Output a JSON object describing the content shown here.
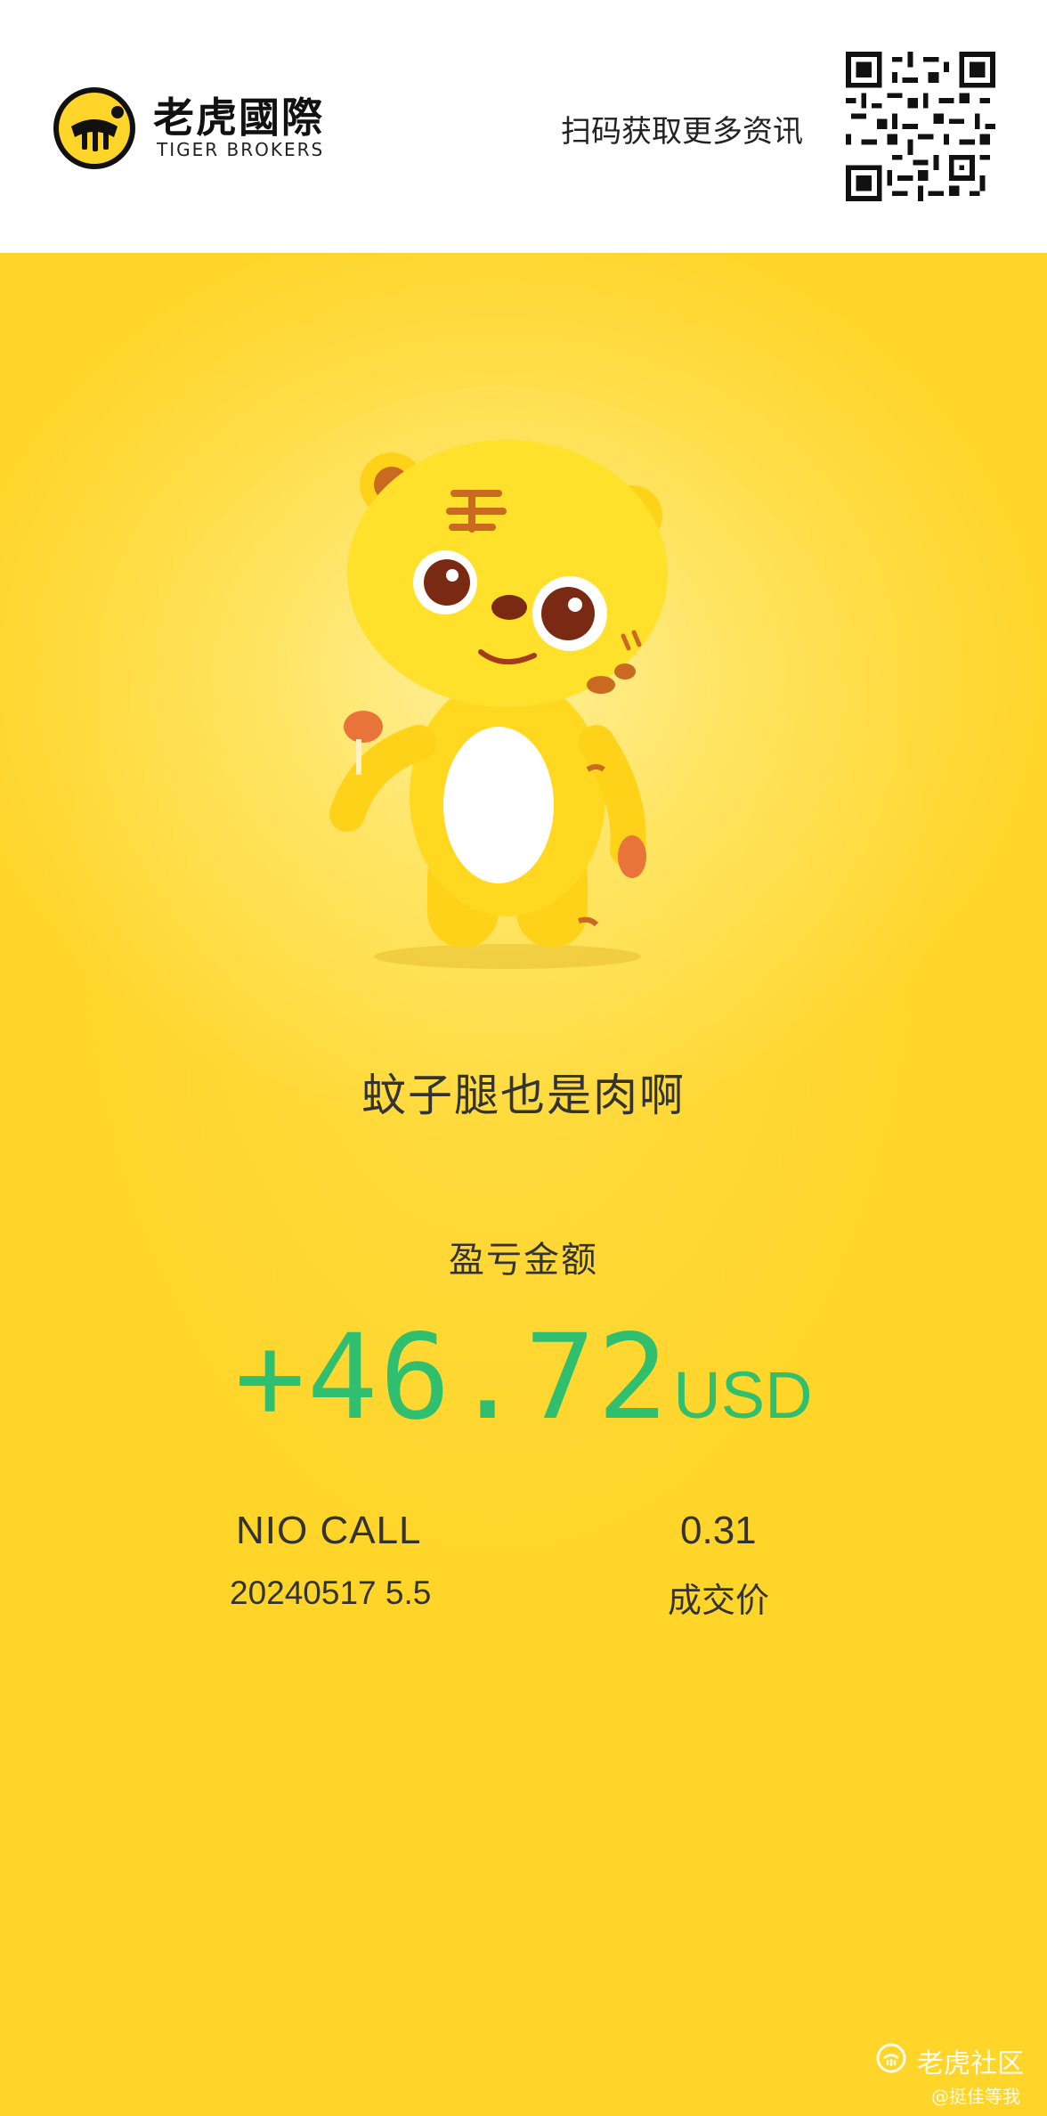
{
  "header": {
    "brand_cn": "老虎國際",
    "brand_en": "TIGER BROKERS",
    "scan_text": "扫码获取更多资讯"
  },
  "icons": {
    "logo": "tiger-logo-icon",
    "qr": "qr-code-icon",
    "mascot": "tiger-mascot-icon",
    "watermark": "tiger-community-icon"
  },
  "colors": {
    "accent_yellow": "#ffd52a",
    "profit_green": "#2fbf6e"
  },
  "card": {
    "caption": "蚊子腿也是肉啊",
    "pl_label": "盈亏金额",
    "pl_value": "+46.72",
    "pl_unit": "USD",
    "symbol": "NIO CALL",
    "contract": "20240517 5.5",
    "price": "0.31",
    "price_label": "成交价"
  },
  "watermark": {
    "text": "老虎社区",
    "sub": "@挺佳等我"
  }
}
